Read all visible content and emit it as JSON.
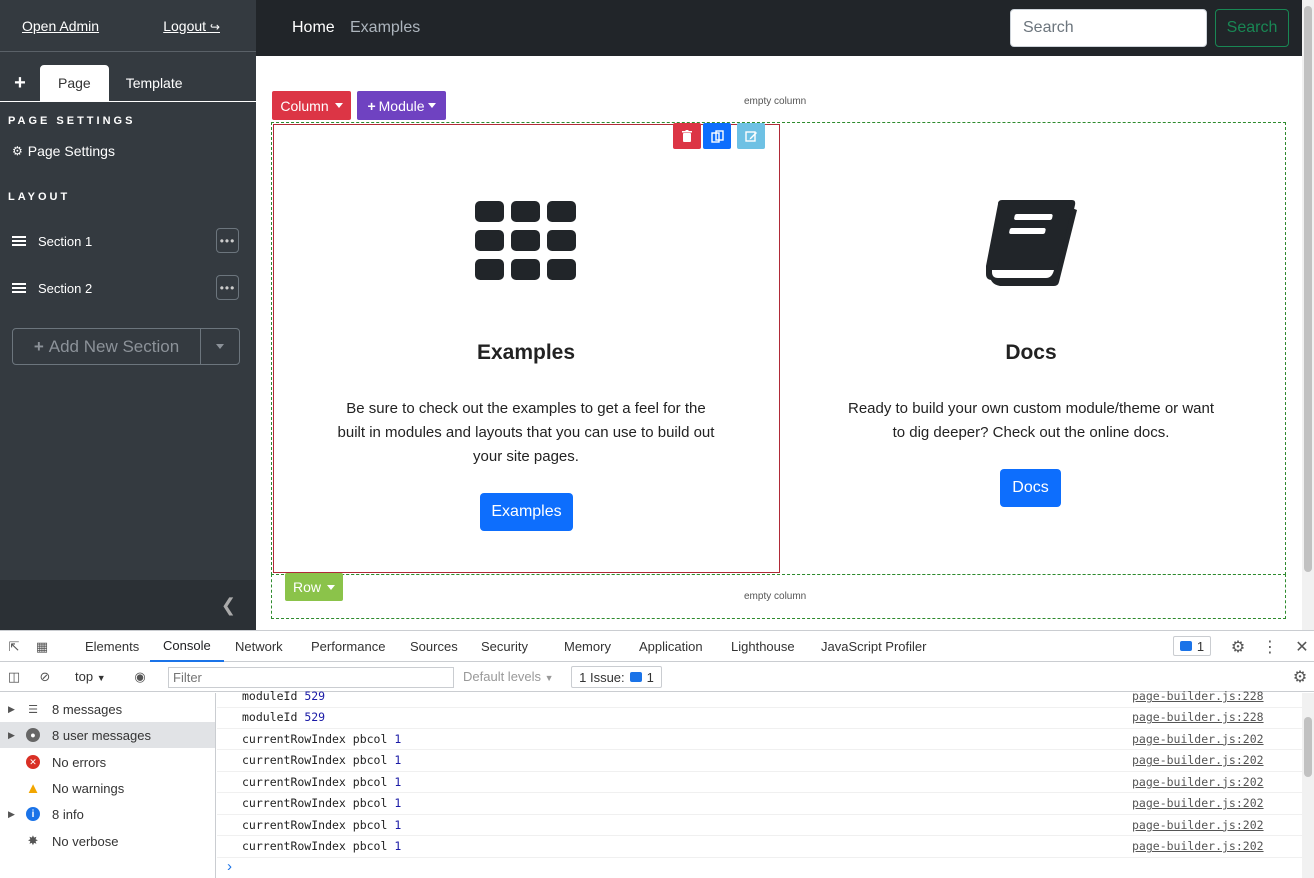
{
  "sidebar": {
    "top_links": [
      "Open Admin",
      "Logout"
    ],
    "tabs": {
      "plus": "+",
      "page": "Page",
      "template": "Template"
    },
    "page_settings_heading": "PAGE SETTINGS",
    "page_settings_link": "Page Settings",
    "layout_heading": "LAYOUT",
    "sections": [
      {
        "label": "Section 1"
      },
      {
        "label": "Section 2"
      }
    ],
    "add_section_label": "Add New Section"
  },
  "navbar": {
    "links": [
      "Home",
      "Examples"
    ],
    "search_placeholder": "Search",
    "search_button": "Search"
  },
  "builder": {
    "column_button": "Column",
    "module_button": "Module",
    "row_button": "Row",
    "empty_column": "empty column",
    "cards": [
      {
        "icon": "grid-icon",
        "title": "Examples",
        "text_lines": [
          "Be sure to check out the examples to get a feel for the",
          "built in modules and layouts that you can use to build out",
          "your site pages."
        ],
        "button": "Examples"
      },
      {
        "icon": "book-icon",
        "title": "Docs",
        "text_lines": [
          "Ready to build your own custom module/theme or want",
          "to dig deeper? Check out the online docs."
        ],
        "button": "Docs"
      }
    ],
    "colors": {
      "column": "#dc3545",
      "module": "#6f42c1",
      "row": "#8bc34a",
      "primary": "#0d6efd"
    }
  },
  "devtools": {
    "tabs": [
      "Elements",
      "Console",
      "Network",
      "Performance",
      "Sources",
      "Security",
      "Memory",
      "Application",
      "Lighthouse",
      "JavaScript Profiler"
    ],
    "active_tab": "Console",
    "issues_badge": "1",
    "context": "top",
    "filter_placeholder": "Filter",
    "levels": "Default levels",
    "issue_label": "1 Issue:",
    "issue_count": "1",
    "sidebar": [
      {
        "label": "8 messages",
        "icon": "list-icon"
      },
      {
        "label": "8 user messages",
        "icon": "user-icon"
      },
      {
        "label": "No errors",
        "icon": "error-icon"
      },
      {
        "label": "No warnings",
        "icon": "warning-icon"
      },
      {
        "label": "8 info",
        "icon": "info-icon"
      },
      {
        "label": "No verbose",
        "icon": "bug-icon"
      }
    ],
    "logs": [
      {
        "text": "moduleId",
        "value": "529",
        "source": "page-builder.js:228"
      },
      {
        "text": "moduleId",
        "value": "529",
        "source": "page-builder.js:228"
      },
      {
        "text": "currentRowIndex pbcol",
        "value": "1",
        "source": "page-builder.js:202"
      },
      {
        "text": "currentRowIndex pbcol",
        "value": "1",
        "source": "page-builder.js:202"
      },
      {
        "text": "currentRowIndex pbcol",
        "value": "1",
        "source": "page-builder.js:202"
      },
      {
        "text": "currentRowIndex pbcol",
        "value": "1",
        "source": "page-builder.js:202"
      },
      {
        "text": "currentRowIndex pbcol",
        "value": "1",
        "source": "page-builder.js:202"
      },
      {
        "text": "currentRowIndex pbcol",
        "value": "1",
        "source": "page-builder.js:202"
      }
    ],
    "prompt": "›"
  }
}
